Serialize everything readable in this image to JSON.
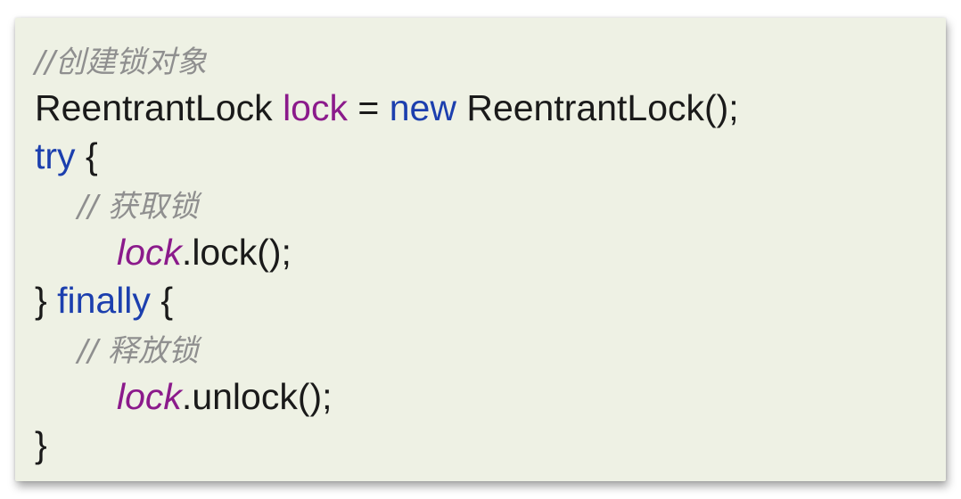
{
  "code": {
    "line1_comment": "//创建锁对象",
    "line2": {
      "type": "ReentrantLock",
      "var": "lock",
      "op": " = ",
      "new": "new",
      "ctor": " ReentrantLock();"
    },
    "line3": {
      "kw": "try",
      "brace": " {"
    },
    "line4_comment": "// 获取锁",
    "line5": {
      "var": "lock",
      "call": ".lock();"
    },
    "line6": {
      "brace": "} ",
      "kw": "finally",
      "brace2": " {"
    },
    "line7_comment": "// 释放锁",
    "line8": {
      "var": "lock",
      "call": ".unlock();"
    },
    "line9": "}"
  },
  "colors": {
    "background": "#eef1e4",
    "keyword": "#1c3fae",
    "variable": "#8b1a8b",
    "comment": "#8f8f8f",
    "text": "#1a1a1a"
  }
}
